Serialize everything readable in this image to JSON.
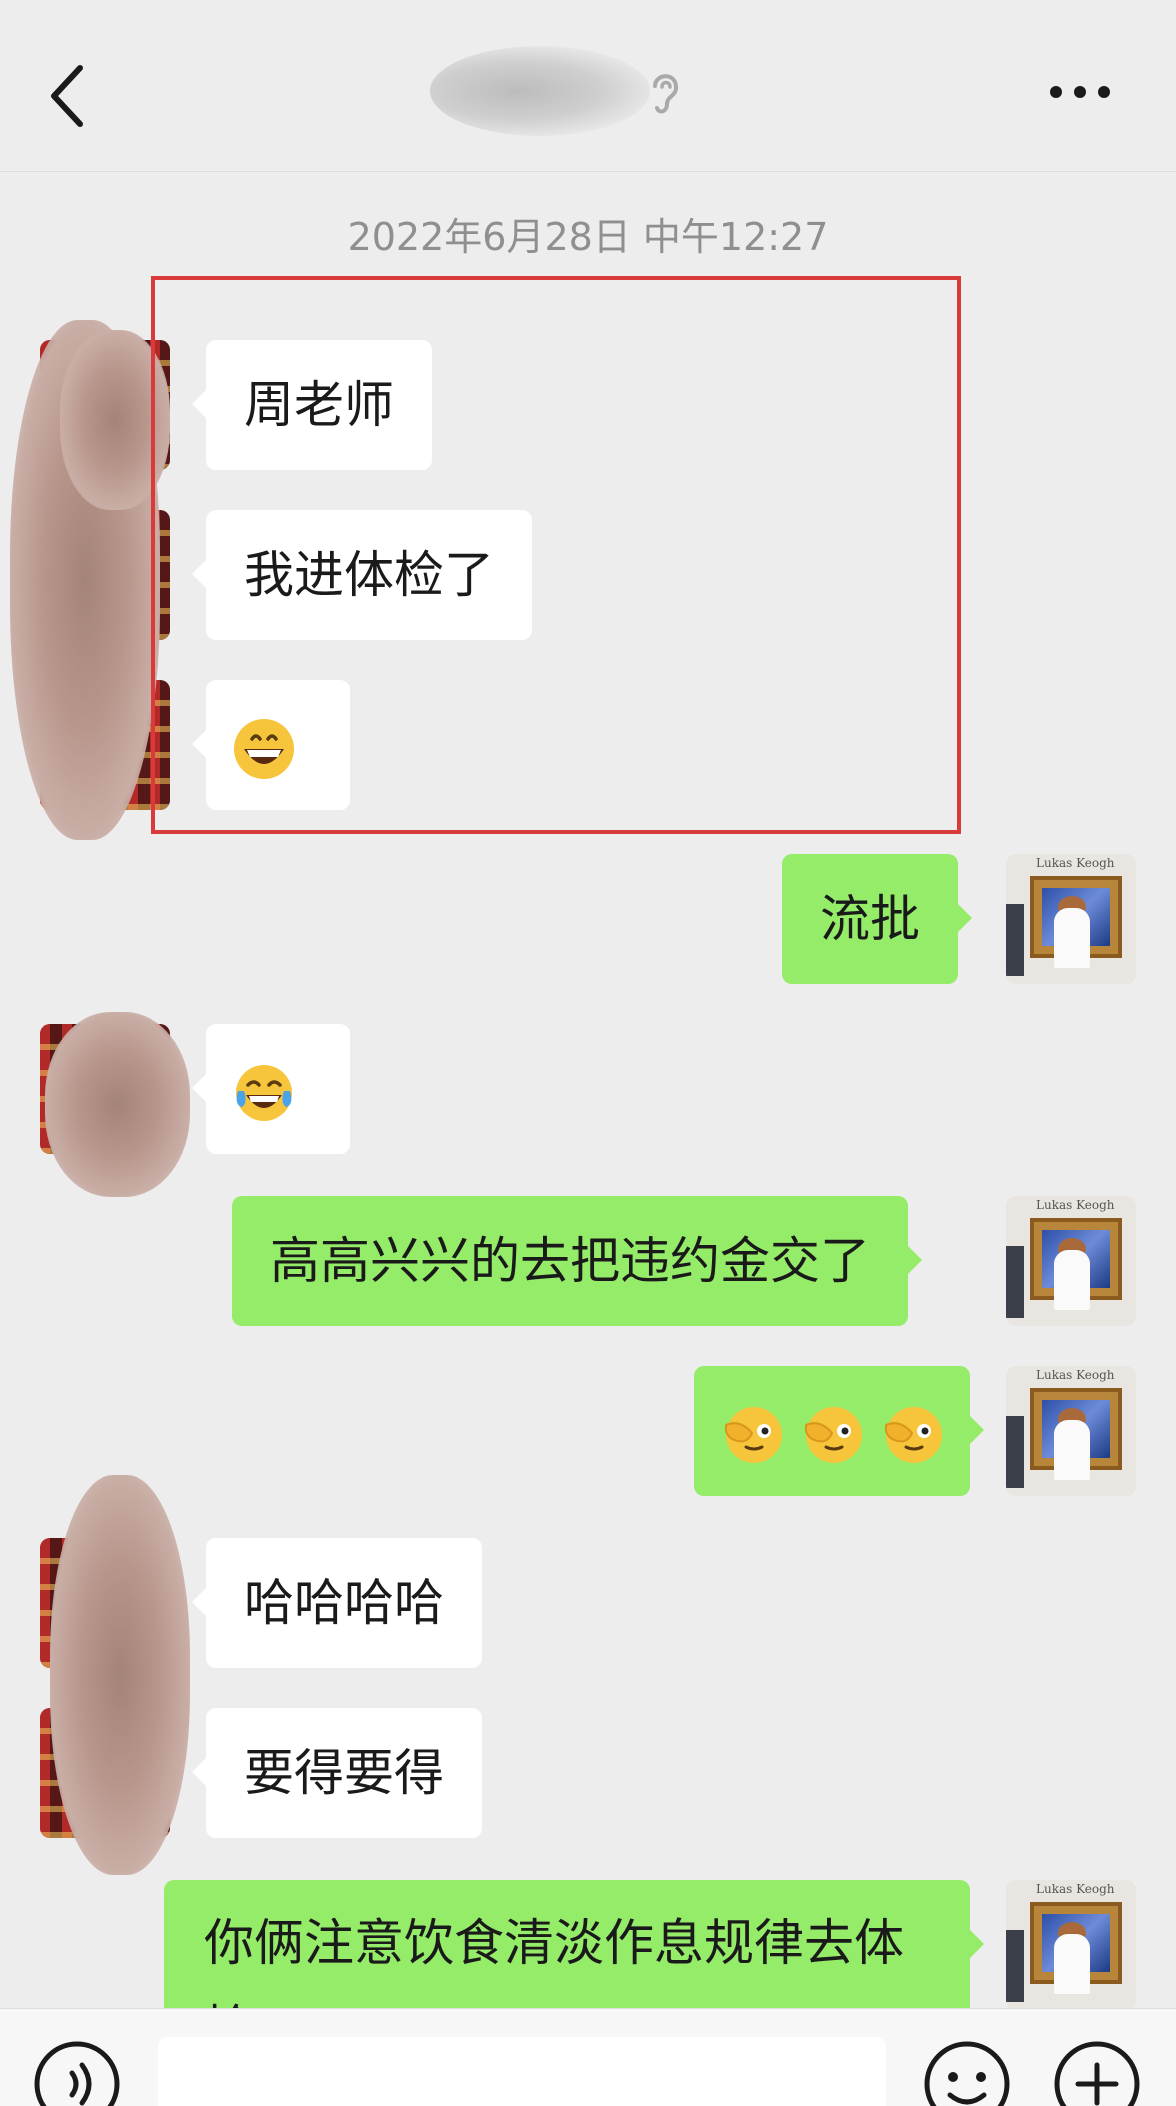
{
  "header": {
    "title": "",
    "back_icon": "chevron-left-icon",
    "more_icon": "more-horizontal-icon",
    "mute_icon": "ear-icon"
  },
  "timestamp": "2022年6月28日 中午12:27",
  "messages": [
    {
      "side": "in",
      "text": "周老师"
    },
    {
      "side": "in",
      "text": "我进体检了"
    },
    {
      "side": "in",
      "emoji": "grinning-face-icon"
    },
    {
      "side": "out",
      "text": "流批"
    },
    {
      "side": "in",
      "emoji": "tears-of-joy-icon"
    },
    {
      "side": "out",
      "text": "高高兴兴的去把违约金交了"
    },
    {
      "side": "out",
      "emoji": "face-palm-icon x3"
    },
    {
      "side": "in",
      "text": "哈哈哈哈"
    },
    {
      "side": "in",
      "text": "要得要得"
    },
    {
      "side": "out",
      "text": "你俩注意饮食清淡作息规律去体检"
    }
  ],
  "bottom_bar": {
    "voice_icon": "voice-icon",
    "emoji_icon": "smiley-icon",
    "plus_icon": "plus-circle-icon",
    "input_value": ""
  },
  "colors": {
    "background": "#ededed",
    "incoming_bubble": "#ffffff",
    "outgoing_bubble": "#95ec69",
    "highlight_border": "#d93a3a",
    "timestamp_text": "#8f8f8f"
  }
}
